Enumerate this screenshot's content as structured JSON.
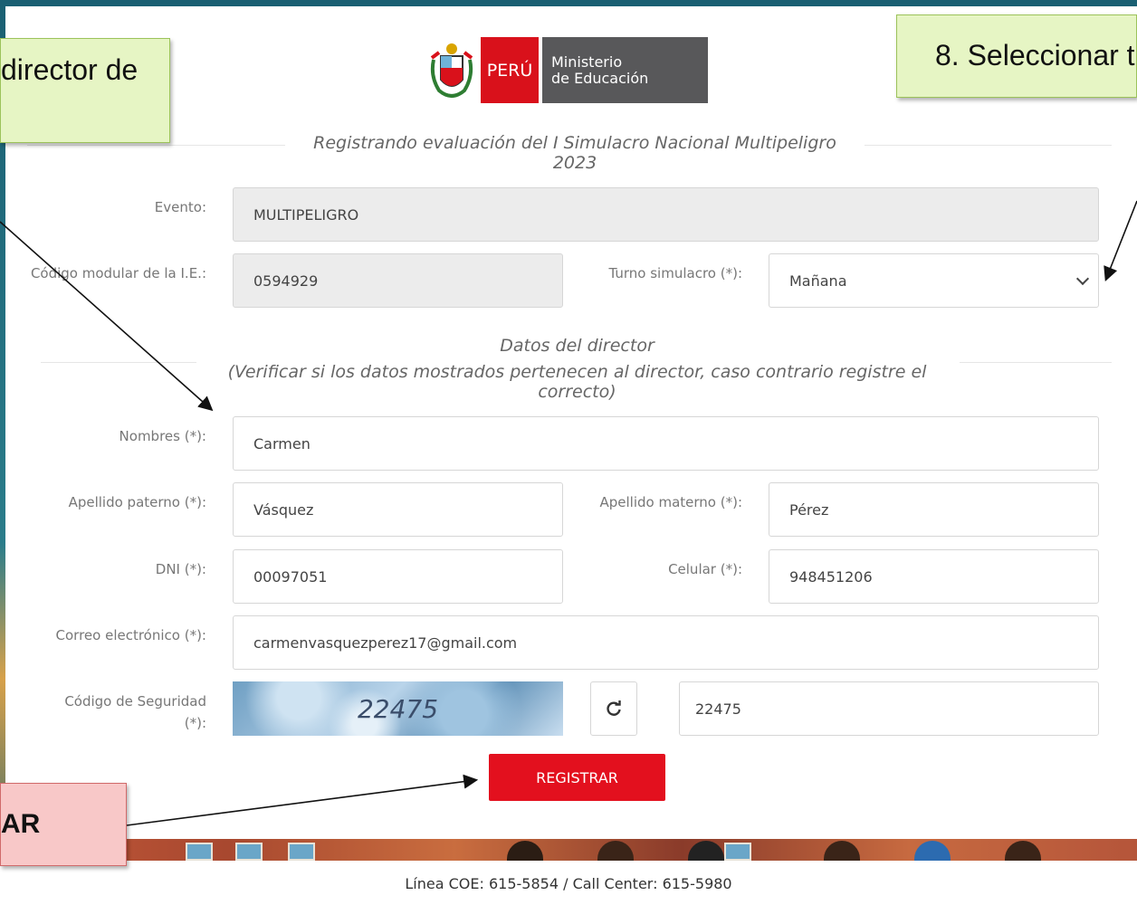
{
  "header": {
    "logo_country": "PERÚ",
    "logo_ministry_line1": "Ministerio",
    "logo_ministry_line2": "de Educación",
    "section_title": "Registrando evaluación del I Simulacro Nacional Multipeligro 2023"
  },
  "form": {
    "evento": {
      "label": "Evento:",
      "value": "MULTIPELIGRO"
    },
    "codigo_modular": {
      "label": "Código modular de la I.E.:",
      "value": "0594929"
    },
    "turno": {
      "label": "Turno simulacro (*):",
      "value": "Mañana"
    },
    "director_section": {
      "title": "Datos del director",
      "subtitle": "(Verificar si los datos mostrados pertenecen al director, caso contrario registre el correcto)"
    },
    "nombres": {
      "label": "Nombres (*):",
      "value": "Carmen"
    },
    "apellido_paterno": {
      "label": "Apellido paterno (*):",
      "value": "Vásquez"
    },
    "apellido_materno": {
      "label": "Apellido materno (*):",
      "value": "Pérez"
    },
    "dni": {
      "label": "DNI (*):",
      "value": "00097051"
    },
    "celular": {
      "label": "Celular (*):",
      "value": "948451206"
    },
    "correo": {
      "label": "Correo electrónico (*):",
      "value": "carmenvasquezperez17@gmail.com"
    },
    "codigo_seguridad": {
      "label": "Código de Seguridad (*):",
      "captcha_text": "22475",
      "value": "22475"
    },
    "register_label": "REGISTRAR"
  },
  "footer": {
    "text": "Línea COE: 615-5854 / Call Center: 615-5980"
  },
  "callouts": {
    "top_left": "director de",
    "top_right": "8. Seleccionar t",
    "bottom_left": "AR"
  },
  "icons": {
    "refresh": "refresh-icon",
    "dropdown": "chevron-down-icon",
    "shield": "coat-of-arms-icon"
  },
  "colors": {
    "accent_red": "#e3101e",
    "peru_red": "#d9111b",
    "ministry_gray": "#58585a",
    "callout_green": "#e6f5c4",
    "callout_pink": "#f8c8c8"
  }
}
